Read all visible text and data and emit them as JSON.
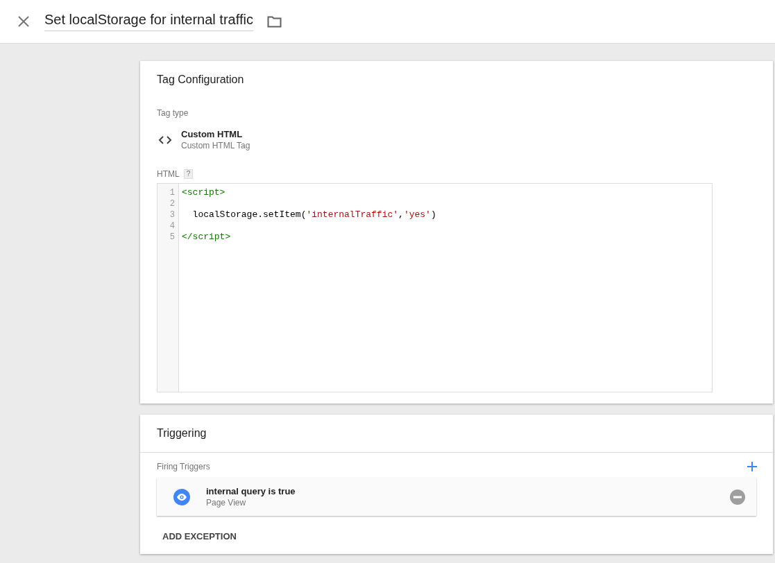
{
  "header": {
    "title": "Set localStorage for internal traffic"
  },
  "tag_configuration": {
    "title": "Tag Configuration",
    "tag_type_label": "Tag type",
    "tag_type": {
      "name": "Custom HTML",
      "description": "Custom HTML Tag"
    },
    "html_label": "HTML",
    "help": "?",
    "code_lines": [
      {
        "number": "1",
        "tokens": [
          {
            "kind": "tag",
            "text": "<script>"
          }
        ]
      },
      {
        "number": "2"
      },
      {
        "number": "3",
        "tokens": [
          {
            "kind": "plain",
            "text": "  localStorage.setItem("
          },
          {
            "kind": "string",
            "text": "'internalTraffic'"
          },
          {
            "kind": "plain",
            "text": ","
          },
          {
            "kind": "string",
            "text": "'yes'"
          },
          {
            "kind": "plain",
            "text": ")"
          }
        ]
      },
      {
        "number": "4"
      },
      {
        "number": "5",
        "tokens": [
          {
            "kind": "tag",
            "text": "</script>"
          }
        ]
      }
    ]
  },
  "triggering": {
    "title": "Triggering",
    "firing_label": "Firing Triggers",
    "triggers": [
      {
        "name": "internal query is true",
        "type": "Page View"
      }
    ],
    "add_exception": "ADD EXCEPTION"
  }
}
